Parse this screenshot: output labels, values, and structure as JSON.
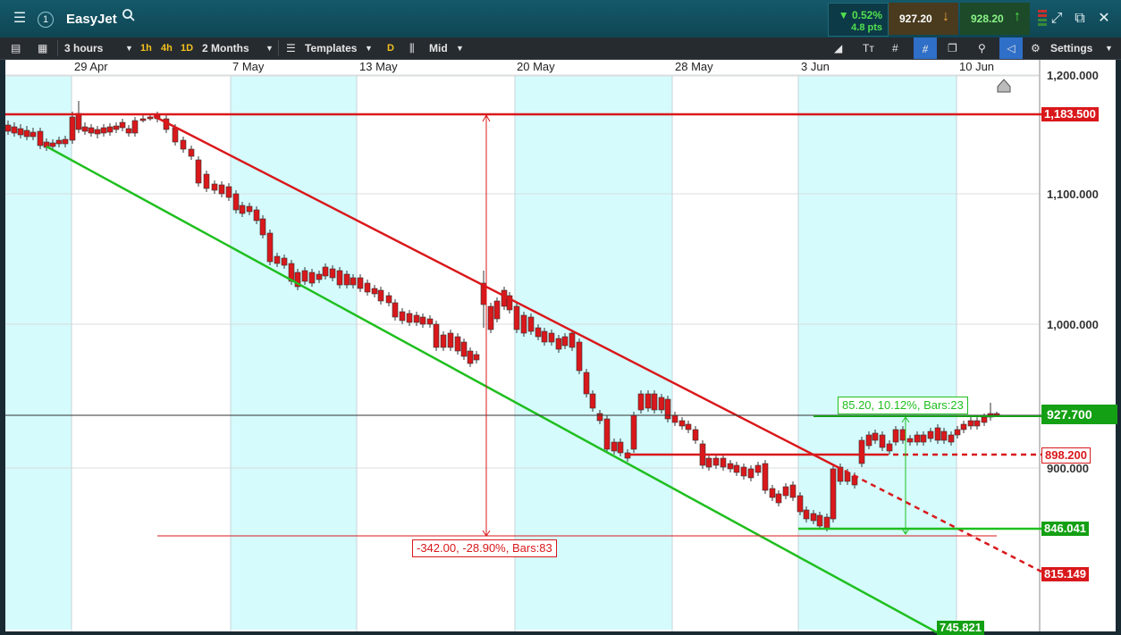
{
  "titlebar": {
    "title": "EasyJet",
    "change_pct": "▼ 0.52%",
    "change_pts": "4.8 pts",
    "sell_price": "927.20",
    "buy_price": "928.20",
    "close_label": "✕"
  },
  "toolbar": {
    "interval": "3 hours",
    "quick_intervals": [
      "1h",
      "4h",
      "1D"
    ],
    "range": "2 Months",
    "templates_label": "Templates",
    "d_label": "D",
    "price_type": "Mid",
    "settings_label": "Settings"
  },
  "chart": {
    "date_labels": [
      "29 Apr",
      "7 May",
      "13 May",
      "20 May",
      "28 May",
      "3 Jun",
      "10 Jun"
    ],
    "axis_labels": [
      "1,200.000",
      "1,100.000",
      "1,000.000",
      "900.000"
    ],
    "price_tags": {
      "resistance": "1,183.500",
      "current": "927.700",
      "level_mid": "898.200",
      "support": "846.041",
      "trend_red_end": "815.149",
      "trend_green_end": "745.821"
    },
    "measure_down": "-342.00, -28.90%, Bars:83",
    "measure_up": "85.20, 10.12%, Bars:23",
    "colors": {
      "up": "#1fbf1f",
      "down": "#d9181b",
      "shade": "#d5fbfd",
      "current": "#14a014"
    }
  }
}
